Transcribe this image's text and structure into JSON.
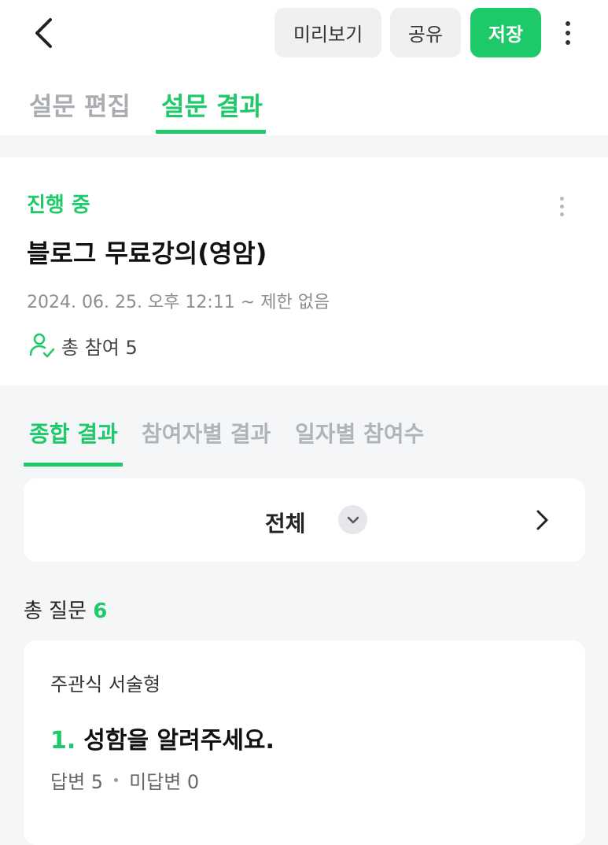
{
  "header": {
    "preview_label": "미리보기",
    "share_label": "공유",
    "save_label": "저장",
    "back_icon": "chevron-left-icon",
    "more_icon": "more-vertical-icon"
  },
  "main_tabs": [
    {
      "label": "설문 편집",
      "active": false
    },
    {
      "label": "설문 결과",
      "active": true
    }
  ],
  "survey": {
    "status": "진행 중",
    "title": "블로그 무료강의(영암)",
    "period": "2024. 06. 25. 오후 12:11 ~ 제한 없음",
    "participants_label": "총 참여 5"
  },
  "sub_tabs": [
    {
      "label": "종합 결과",
      "active": true
    },
    {
      "label": "참여자별 결과",
      "active": false
    },
    {
      "label": "일자별 참여수",
      "active": false
    }
  ],
  "filter": {
    "label": "전체"
  },
  "questions_summary": {
    "label": "총 질문",
    "count": "6"
  },
  "question": {
    "type": "주관식 서술형",
    "number": "1.",
    "title": "성함을 알려주세요.",
    "answered": "답변 5",
    "unanswered": "미답변 0"
  },
  "colors": {
    "accent": "#1ec96a",
    "background": "#f5f6f8",
    "muted": "#a9acb1"
  }
}
